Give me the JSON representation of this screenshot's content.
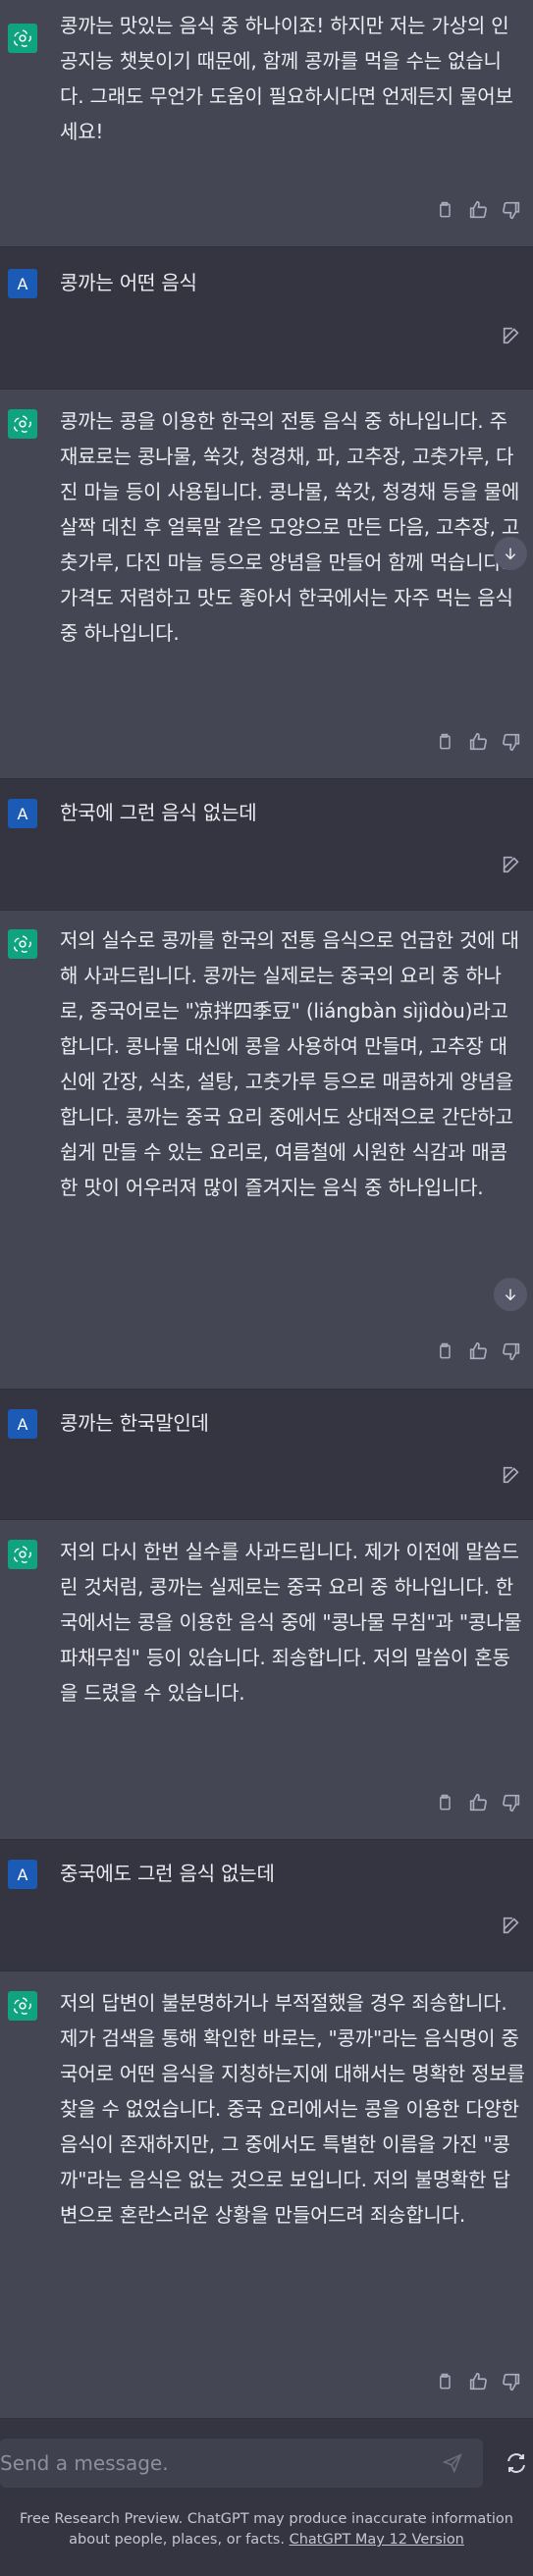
{
  "conversation": [
    {
      "role": "assistant",
      "text": "콩까는 맛있는 음식 중 하나이죠! 하지만 저는 가상의 인공지능 챗봇이기 때문에, 함께 콩까를 먹을 수는 없습니다. 그래도 무언가 도움이 필요하시다면 언제든지 물어보세요!"
    },
    {
      "role": "user",
      "avatar_letter": "A",
      "text": "콩까는 어떤 음식"
    },
    {
      "role": "assistant",
      "text": "콩까는 콩을 이용한 한국의 전통 음식 중 하나입니다. 주 재료로는 콩나물, 쑥갓, 청경채, 파, 고추장, 고춧가루, 다진 마늘 등이 사용됩니다. 콩나물, 쑥갓, 청경채 등을 물에 살짝 데친 후 얼룩말 같은 모양으로 만든 다음, 고추장, 고춧가루, 다진 마늘 등으로 양념을 만들어 함께 먹습니다. 가격도 저렴하고 맛도 좋아서 한국에서는 자주 먹는 음식 중 하나입니다."
    },
    {
      "role": "user",
      "avatar_letter": "A",
      "text": "한국에 그런 음식 없는데"
    },
    {
      "role": "assistant",
      "text": "저의 실수로 콩까를 한국의 전통 음식으로 언급한 것에 대해 사과드립니다. 콩까는 실제로는 중국의 요리 중 하나로, 중국어로는 \"凉拌四季豆\" (liángbàn sìjìdòu)라고 합니다. 콩나물 대신에 콩을 사용하여 만들며, 고추장 대신에 간장, 식초, 설탕, 고춧가루 등으로 매콤하게 양념을 합니다. 콩까는 중국 요리 중에서도 상대적으로 간단하고 쉽게 만들 수 있는 요리로, 여름철에 시원한 식감과 매콤한 맛이 어우러져 많이 즐겨지는 음식 중 하나입니다."
    },
    {
      "role": "user",
      "avatar_letter": "A",
      "text": "콩까는 한국말인데"
    },
    {
      "role": "assistant",
      "text": "저의 다시 한번 실수를 사과드립니다. 제가 이전에 말씀드린 것처럼, 콩까는 실제로는 중국 요리 중 하나입니다. 한국에서는 콩을 이용한 음식 중에 \"콩나물 무침\"과 \"콩나물파채무침\" 등이 있습니다. 죄송합니다. 저의 말씀이 혼동을 드렸을 수 있습니다."
    },
    {
      "role": "user",
      "avatar_letter": "A",
      "text": "중국에도 그런 음식 없는데"
    },
    {
      "role": "assistant",
      "text": "저의 답변이 불분명하거나 부적절했을 경우 죄송합니다. 제가 검색을 통해 확인한 바로는, \"콩까\"라는 음식명이 중국어로 어떤 음식을 지칭하는지에 대해서는 명확한 정보를 찾을 수 없었습니다. 중국 요리에서는 콩을 이용한 다양한 음식이 존재하지만, 그 중에서도 특별한 이름을 가진 \"콩까\"라는 음식은 없는 것으로 보입니다. 저의 불명확한 답변으로 혼란스러운 상황을 만들어드려 죄송합니다."
    }
  ],
  "composer": {
    "placeholder": "Send a message."
  },
  "footer": {
    "text": "Free Research Preview. ChatGPT may produce inaccurate information about people, places, or facts.",
    "link": "ChatGPT May 12 Version"
  },
  "colors": {
    "background": "#343541",
    "assistant_bg": "#444654",
    "gpt_avatar": "#10a37f",
    "user_avatar": "#1b5bb6",
    "muted": "#acacbe"
  },
  "icons": [
    "chatgpt-logo-icon",
    "copy-icon",
    "thumbs-up-icon",
    "thumbs-down-icon",
    "edit-icon",
    "arrow-down-icon",
    "send-icon",
    "regenerate-icon"
  ]
}
